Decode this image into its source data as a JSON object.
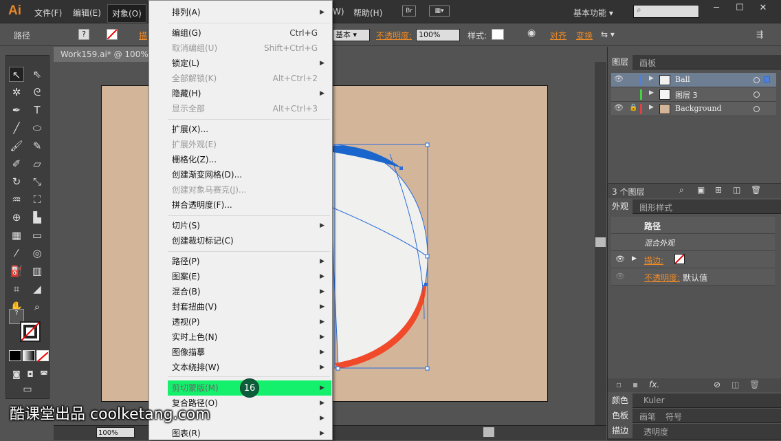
{
  "app": {
    "logo": "Ai"
  },
  "menubar": {
    "items": [
      "文件(F)",
      "编辑(E)",
      "对象(O)",
      "W)",
      "帮助(H)"
    ],
    "br_label": "Br",
    "workspace": "基本功能",
    "search_placeholder": ""
  },
  "control_bar": {
    "object_label": "路径",
    "stroke_label": "描",
    "stroke_style": "基本",
    "opacity_label": "不透明度:",
    "opacity_value": "100%",
    "style_label": "样式:",
    "align_label": "对齐",
    "transform_label": "变换"
  },
  "document": {
    "tab_title": "Work159.ai* @ 100%",
    "zoom": "100%"
  },
  "object_menu": {
    "items": [
      {
        "label": "排列(A)",
        "shortcut": "",
        "submenu": true,
        "disabled": false
      },
      {
        "label": "编组(G)",
        "shortcut": "Ctrl+G",
        "submenu": false,
        "disabled": false
      },
      {
        "label": "取消编组(U)",
        "shortcut": "Shift+Ctrl+G",
        "submenu": false,
        "disabled": true
      },
      {
        "label": "锁定(L)",
        "shortcut": "",
        "submenu": true,
        "disabled": false
      },
      {
        "label": "全部解锁(K)",
        "shortcut": "Alt+Ctrl+2",
        "submenu": false,
        "disabled": true
      },
      {
        "label": "隐藏(H)",
        "shortcut": "",
        "submenu": true,
        "disabled": false
      },
      {
        "label": "显示全部",
        "shortcut": "Alt+Ctrl+3",
        "submenu": false,
        "disabled": true
      },
      {
        "label": "扩展(X)...",
        "shortcut": "",
        "submenu": false,
        "disabled": false
      },
      {
        "label": "扩展外观(E)",
        "shortcut": "",
        "submenu": false,
        "disabled": true
      },
      {
        "label": "栅格化(Z)...",
        "shortcut": "",
        "submenu": false,
        "disabled": false
      },
      {
        "label": "创建渐变网格(D)...",
        "shortcut": "",
        "submenu": false,
        "disabled": false
      },
      {
        "label": "创建对象马赛克(J)...",
        "shortcut": "",
        "submenu": false,
        "disabled": true
      },
      {
        "label": "拼合透明度(F)...",
        "shortcut": "",
        "submenu": false,
        "disabled": false
      },
      {
        "label": "切片(S)",
        "shortcut": "",
        "submenu": true,
        "disabled": false
      },
      {
        "label": "创建裁切标记(C)",
        "shortcut": "",
        "submenu": false,
        "disabled": false
      },
      {
        "label": "路径(P)",
        "shortcut": "",
        "submenu": true,
        "disabled": false
      },
      {
        "label": "图案(E)",
        "shortcut": "",
        "submenu": true,
        "disabled": false
      },
      {
        "label": "混合(B)",
        "shortcut": "",
        "submenu": true,
        "disabled": false
      },
      {
        "label": "封套扭曲(V)",
        "shortcut": "",
        "submenu": true,
        "disabled": false
      },
      {
        "label": "透视(P)",
        "shortcut": "",
        "submenu": true,
        "disabled": false
      },
      {
        "label": "实时上色(N)",
        "shortcut": "",
        "submenu": true,
        "disabled": false
      },
      {
        "label": "图像描摹",
        "shortcut": "",
        "submenu": true,
        "disabled": false
      },
      {
        "label": "文本绕排(W)",
        "shortcut": "",
        "submenu": true,
        "disabled": false
      },
      {
        "label": "剪切蒙版(M)",
        "shortcut": "",
        "submenu": true,
        "disabled": false,
        "highlighted": true
      },
      {
        "label": "复合路径(O)",
        "shortcut": "",
        "submenu": true,
        "disabled": false
      },
      {
        "label": "",
        "shortcut": "",
        "submenu": true,
        "disabled": false
      },
      {
        "label": "图表(R)",
        "shortcut": "",
        "submenu": true,
        "disabled": false
      }
    ],
    "step_badge": "16"
  },
  "layers_panel": {
    "tabs": [
      "图层",
      "画板"
    ],
    "layers": [
      {
        "name": "Ball",
        "color": "#4f7fd6",
        "visible": true,
        "locked": false,
        "selected": true
      },
      {
        "name": "图层 3",
        "color": "#3fd63f",
        "visible": false,
        "locked": false,
        "selected": false
      },
      {
        "name": "Background",
        "color": "#e04040",
        "visible": true,
        "locked": true,
        "selected": false
      }
    ],
    "count_label": "3 个图层"
  },
  "appearance_panel": {
    "tabs": [
      "外观",
      "图形样式"
    ],
    "title": "路径",
    "mixed": "混合外观",
    "stroke_label": "描边:",
    "opacity_label": "不透明度:",
    "opacity_value": "默认值"
  },
  "bottom_panels": {
    "row1": [
      "颜色",
      "Kuler"
    ],
    "row2": [
      "色板",
      "画笔",
      "符号"
    ],
    "row3": [
      "描边",
      "透明度"
    ]
  },
  "watermark": "酷课堂出品 coolketang.com",
  "colors": {
    "highlight": "#14f06c",
    "artboard": "#d3b59a",
    "selection": "#2a6dd9",
    "accent_red": "#f04a2a"
  }
}
